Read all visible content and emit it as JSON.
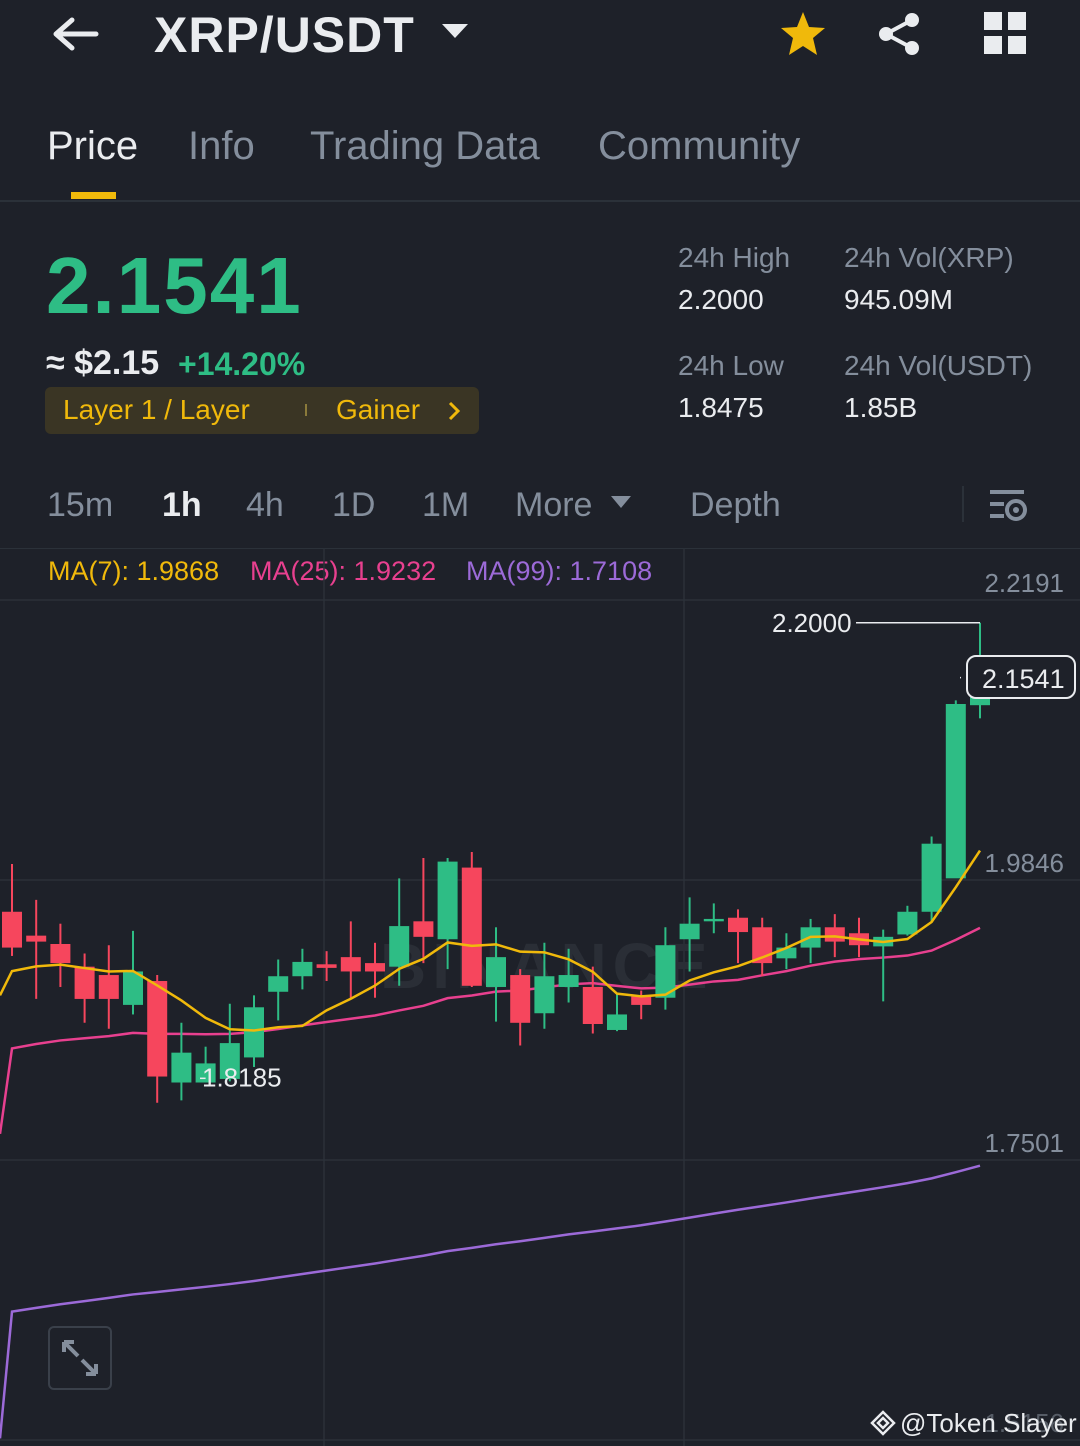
{
  "header": {
    "pair": "XRP/USDT"
  },
  "tabs": [
    {
      "label": "Price"
    },
    {
      "label": "Info"
    },
    {
      "label": "Trading Data"
    },
    {
      "label": "Community"
    }
  ],
  "ticker": {
    "last_price": "2.1541",
    "fiat_price": "≈ $2.15",
    "change_pct": "+14.20%",
    "tag_category": "Layer 1 / Layer",
    "tag_gainer": "Gainer",
    "stats": {
      "high_label": "24h High",
      "high_value": "2.2000",
      "low_label": "24h Low",
      "low_value": "1.8475",
      "vol_base_label": "24h Vol(XRP)",
      "vol_base_value": "945.09M",
      "vol_quote_label": "24h Vol(USDT)",
      "vol_quote_value": "1.85B"
    }
  },
  "intervals": [
    {
      "label": "15m"
    },
    {
      "label": "1h"
    },
    {
      "label": "4h"
    },
    {
      "label": "1D"
    },
    {
      "label": "1M"
    }
  ],
  "more_label": "More",
  "depth_label": "Depth",
  "ma_legend": {
    "ma7": "MA(7): 1.9868",
    "ma25": "MA(25): 1.9232",
    "ma99": "MA(99): 1.7108"
  },
  "colors": {
    "up": "#2ebd85",
    "down": "#f6465d",
    "ma7": "#f0b90b",
    "ma25": "#e8408f",
    "ma99": "#9c6ad8",
    "accent": "#f0b90b",
    "background": "#1e2129"
  },
  "watermark": "BINANCE",
  "credit": "@Token Slayer",
  "chart_data": {
    "type": "candlestick",
    "y_ticks": [
      "2.2191",
      "1.9846",
      "1.7501",
      "1.5156"
    ],
    "ylim": [
      1.5156,
      2.2191
    ],
    "high_marker": "2.2000",
    "low_marker": "1.8185",
    "current_price_label": "2.1541",
    "candles": [
      [
        1.958,
        1.928,
        1.998,
        1.921
      ],
      [
        1.938,
        1.933,
        1.968,
        1.885
      ],
      [
        1.931,
        1.915,
        1.948,
        1.895
      ],
      [
        1.912,
        1.885,
        1.923,
        1.865
      ],
      [
        1.905,
        1.885,
        1.93,
        1.86
      ],
      [
        1.88,
        1.908,
        1.942,
        1.872
      ],
      [
        1.9,
        1.82,
        1.905,
        1.798
      ],
      [
        1.815,
        1.84,
        1.865,
        1.8
      ],
      [
        1.815,
        1.831,
        1.845,
        1.8185
      ],
      [
        1.818,
        1.848,
        1.881,
        1.816
      ],
      [
        1.836,
        1.878,
        1.888,
        1.828
      ],
      [
        1.891,
        1.904,
        1.918,
        1.867
      ],
      [
        1.904,
        1.916,
        1.927,
        1.893
      ],
      [
        1.914,
        1.911,
        1.925,
        1.9
      ],
      [
        1.92,
        1.908,
        1.95,
        1.885
      ],
      [
        1.915,
        1.908,
        1.932,
        1.886
      ],
      [
        1.912,
        1.946,
        1.986,
        1.896
      ],
      [
        1.95,
        1.937,
        2.003,
        1.915
      ],
      [
        1.935,
        2.0,
        2.003,
        1.91
      ],
      [
        1.995,
        1.896,
        2.008,
        1.895
      ],
      [
        1.895,
        1.92,
        1.945,
        1.866
      ],
      [
        1.905,
        1.865,
        1.91,
        1.846
      ],
      [
        1.873,
        1.904,
        1.932,
        1.86
      ],
      [
        1.895,
        1.905,
        1.927,
        1.882
      ],
      [
        1.895,
        1.864,
        1.912,
        1.856
      ],
      [
        1.859,
        1.872,
        1.89,
        1.858
      ],
      [
        1.887,
        1.88,
        1.892,
        1.868
      ],
      [
        1.886,
        1.93,
        1.945,
        1.876
      ],
      [
        1.935,
        1.948,
        1.97,
        1.908
      ],
      [
        1.95,
        1.952,
        1.965,
        1.94
      ],
      [
        1.953,
        1.941,
        1.96,
        1.915
      ],
      [
        1.945,
        1.915,
        1.953,
        1.904
      ],
      [
        1.919,
        1.928,
        1.94,
        1.91
      ],
      [
        1.928,
        1.945,
        1.952,
        1.915
      ],
      [
        1.945,
        1.933,
        1.956,
        1.92
      ],
      [
        1.94,
        1.93,
        1.953,
        1.92
      ],
      [
        1.929,
        1.937,
        1.943,
        1.883
      ],
      [
        1.939,
        1.958,
        1.963,
        1.938
      ],
      [
        1.958,
        2.015,
        2.021,
        1.95
      ],
      [
        1.986,
        2.132,
        2.135,
        1.987
      ],
      [
        2.131,
        2.16,
        2.2,
        2.12
      ]
    ]
  }
}
